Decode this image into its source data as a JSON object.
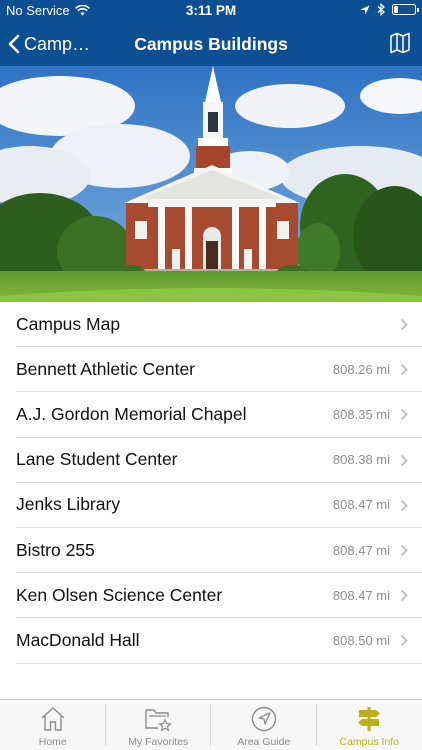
{
  "status_bar": {
    "carrier": "No Service",
    "time": "3:11 PM"
  },
  "nav": {
    "back_label": "Camp…",
    "title": "Campus Buildings"
  },
  "buildings": [
    {
      "name": "Campus Map",
      "distance": ""
    },
    {
      "name": "Bennett Athletic Center",
      "distance": "808.26 mi"
    },
    {
      "name": "A.J. Gordon Memorial Chapel",
      "distance": "808.35 mi"
    },
    {
      "name": "Lane Student Center",
      "distance": "808.38 mi"
    },
    {
      "name": "Jenks Library",
      "distance": "808.47 mi"
    },
    {
      "name": "Bistro 255",
      "distance": "808.47 mi"
    },
    {
      "name": "Ken Olsen Science Center",
      "distance": "808.47 mi"
    },
    {
      "name": "MacDonald Hall",
      "distance": "808.50 mi"
    }
  ],
  "tabs": [
    {
      "label": "Home",
      "icon": "home-icon"
    },
    {
      "label": "My Favorites",
      "icon": "favorites-folder-icon"
    },
    {
      "label": "Area Guide",
      "icon": "compass-icon"
    },
    {
      "label": "Campus Info",
      "icon": "signpost-icon",
      "active": true
    }
  ],
  "colors": {
    "header": "#0d4f93",
    "active_tab": "#b8b019",
    "inactive_tab": "#8c8c8c"
  }
}
